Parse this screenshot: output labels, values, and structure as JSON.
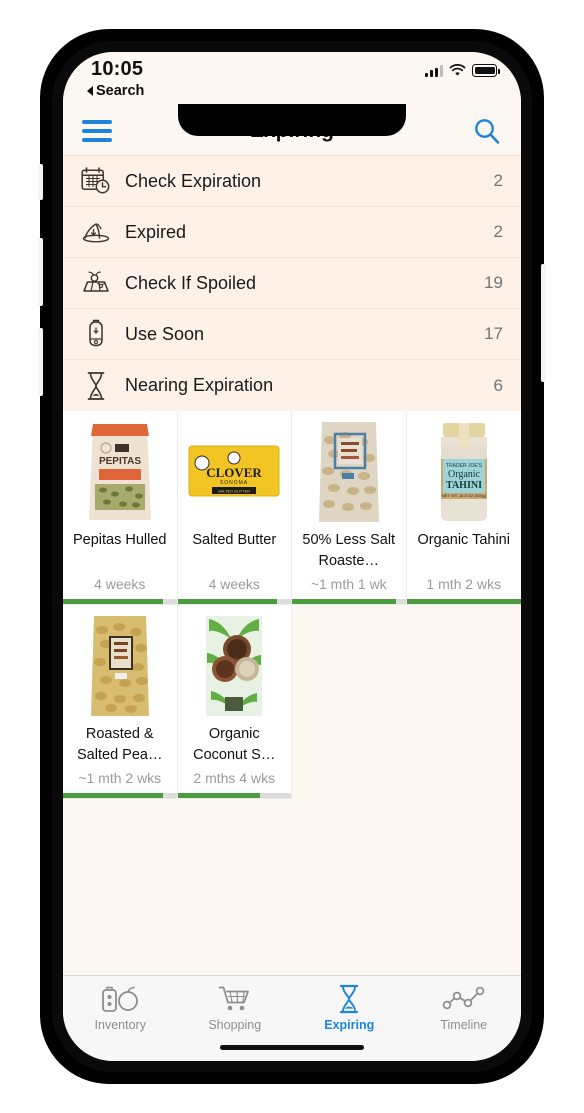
{
  "status_bar": {
    "time": "10:05",
    "back_label": "Search",
    "back_icon": "triangle-left-icon",
    "signal_icon": "cellular-signal-icon",
    "wifi_icon": "wifi-icon",
    "battery_icon": "battery-full-icon"
  },
  "nav": {
    "title": "Expiring",
    "menu_icon": "hamburger-menu-icon",
    "search_icon": "search-icon",
    "accent_color": "#1c84dd"
  },
  "categories": {
    "background_color": "#fdf1e8",
    "items": [
      {
        "icon": "calendar-clock-icon",
        "label": "Check Expiration",
        "count": "2"
      },
      {
        "icon": "spoiled-melting-icon",
        "label": "Expired",
        "count": "2"
      },
      {
        "icon": "crate-flies-icon",
        "label": "Check If Spoiled",
        "count": "19"
      },
      {
        "icon": "jar-icon",
        "label": "Use Soon",
        "count": "17"
      },
      {
        "icon": "hourglass-icon",
        "label": "Nearing Expiration",
        "count": "6"
      }
    ]
  },
  "products": {
    "bar_fill_color": "#4a9c3f",
    "bar_track_color": "#dcdcdc",
    "items": [
      {
        "name": "Pepitas Hulled",
        "time": "4 weeks",
        "image": "pepitas-bag-image",
        "progress": 88
      },
      {
        "name": "Salted Butter",
        "time": "4 weeks",
        "image": "clover-butter-image",
        "progress": 88
      },
      {
        "name": "50% Less Salt Roaste…",
        "time": "~1 mth 1 wk",
        "image": "peanuts-bag-image",
        "progress": 92
      },
      {
        "name": "Organic Tahini",
        "time": "1 mth 2 wks",
        "image": "tahini-jar-image",
        "progress": 100
      },
      {
        "name": "Roasted & Salted Pea…",
        "time": "~1 mth 2 wks",
        "image": "roasted-peanuts-image",
        "progress": 88
      },
      {
        "name": "Organic Coconut S…",
        "time": "2 mths 4 wks",
        "image": "coconut-bag-image",
        "progress": 73
      }
    ]
  },
  "tabs": {
    "active_color": "#1c84dd",
    "inactive_color": "#8e8e8e",
    "items": [
      {
        "icon": "jar-fruit-icon",
        "label": "Inventory",
        "active": false
      },
      {
        "icon": "shopping-cart-icon",
        "label": "Shopping",
        "active": false
      },
      {
        "icon": "hourglass-icon",
        "label": "Expiring",
        "active": true
      },
      {
        "icon": "timeline-chart-icon",
        "label": "Timeline",
        "active": false
      }
    ]
  }
}
